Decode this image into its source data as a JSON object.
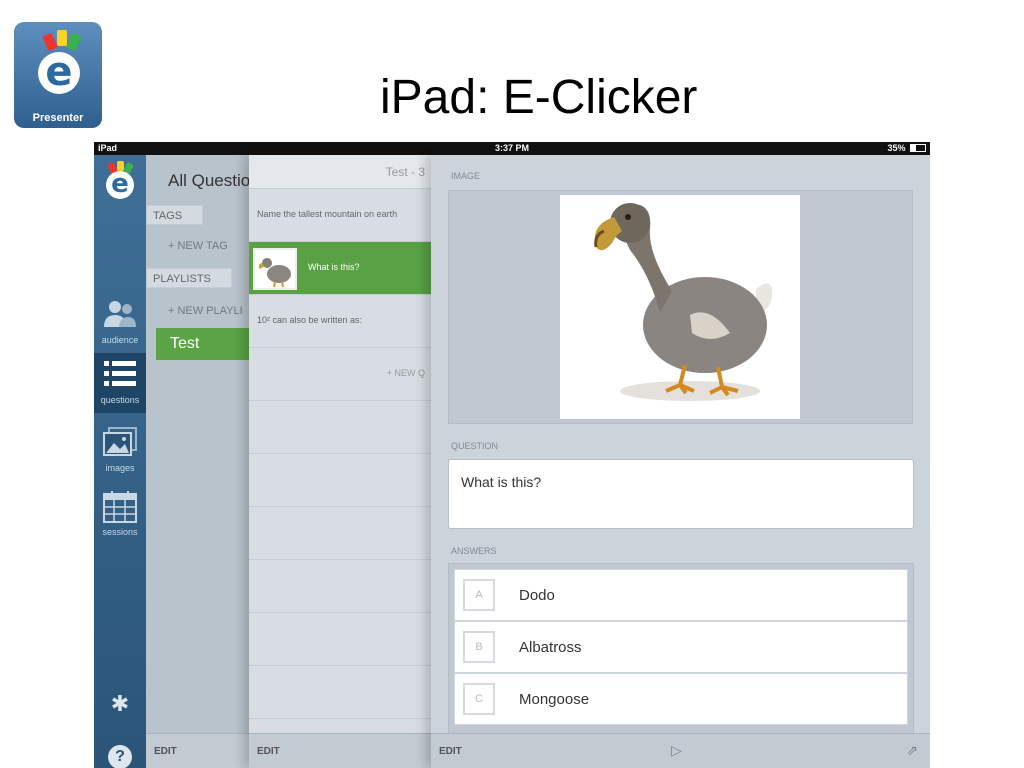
{
  "app_icon": {
    "label": "Presenter",
    "glyph": "e"
  },
  "slide_title": "iPad: E-Clicker",
  "status_bar": {
    "carrier": "iPad",
    "time": "3:37 PM",
    "battery": "35%"
  },
  "rail": {
    "logo_glyph": "e",
    "items": [
      {
        "label": "audience",
        "icon": "people-icon"
      },
      {
        "label": "questions",
        "icon": "list-icon",
        "active": true
      },
      {
        "label": "images",
        "icon": "image-icon"
      },
      {
        "label": "sessions",
        "icon": "calendar-icon"
      }
    ],
    "gear_glyph": "✱",
    "help_glyph": "?"
  },
  "col1": {
    "header": "All Questio",
    "tags_label": "TAGS",
    "new_tag": "+ NEW TAG",
    "playlists_label": "PLAYLISTS",
    "new_playlist": "+ NEW PLAYLI",
    "selected_playlist": "Test",
    "footer": "EDIT"
  },
  "col2": {
    "header": "Test - 3",
    "rows": [
      "Name the tallest mountain on earth",
      "What is this?",
      "10² can also be written as:",
      "+ NEW Q"
    ],
    "footer": "EDIT"
  },
  "detail": {
    "image_label": "IMAGE",
    "question_label": "QUESTION",
    "question_text": "What is this?",
    "answers_label": "ANSWERS",
    "answers": [
      {
        "letter": "A",
        "text": "Dodo"
      },
      {
        "letter": "B",
        "text": "Albatross"
      },
      {
        "letter": "C",
        "text": "Mongoose"
      }
    ],
    "footer": "EDIT",
    "play_glyph": "▷",
    "share_glyph": "⇗"
  },
  "colors": {
    "accent_green": "#5aa445",
    "rail_blue": "#3f6f97"
  }
}
